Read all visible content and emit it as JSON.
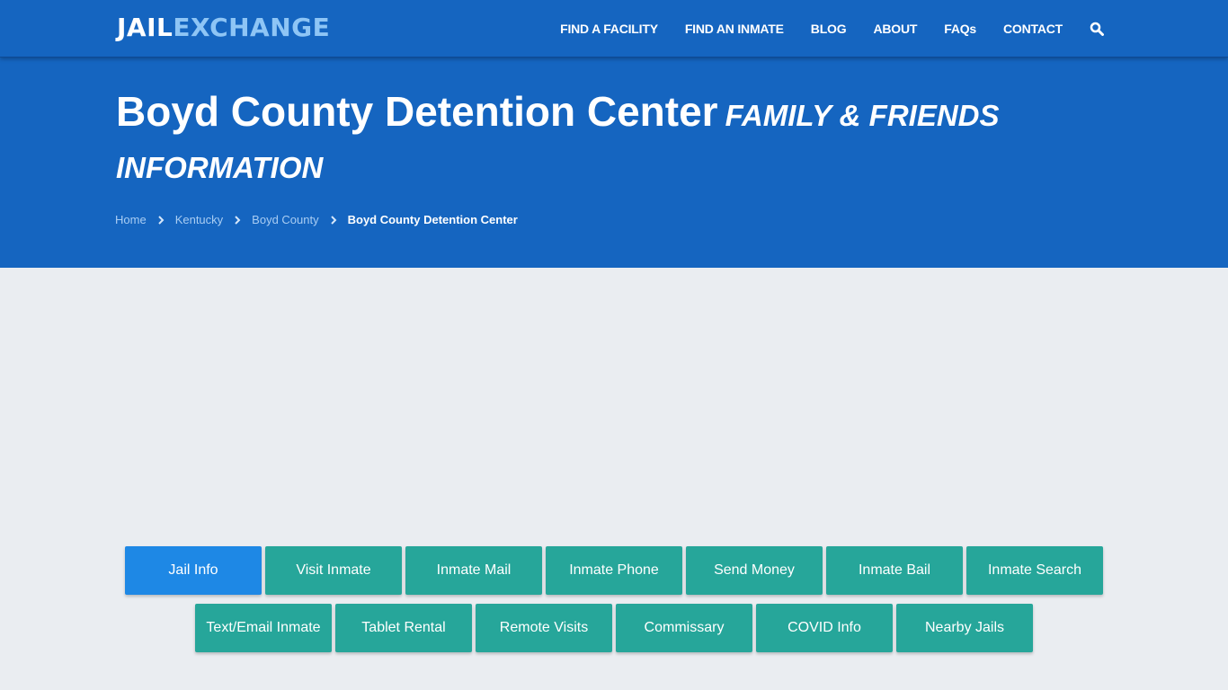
{
  "header": {
    "logo": {
      "part1": "JAIL",
      "part2": "EXCHANGE"
    },
    "nav": [
      {
        "label": "FIND A FACILITY"
      },
      {
        "label": "FIND AN INMATE"
      },
      {
        "label": "BLOG"
      },
      {
        "label": "ABOUT"
      },
      {
        "label": "FAQs"
      },
      {
        "label": "CONTACT"
      }
    ],
    "search_icon": "search-icon"
  },
  "hero": {
    "title": "Boyd County Detention Center",
    "subtitle": "FAMILY & FRIENDS INFORMATION",
    "breadcrumb": [
      {
        "label": "Home"
      },
      {
        "label": "Kentucky"
      },
      {
        "label": "Boyd County"
      },
      {
        "label": "Boyd County Detention Center"
      }
    ]
  },
  "colors": {
    "brand_blue": "#1565c0",
    "logo_accent": "#8ec5f5",
    "button_teal": "#26a69a",
    "button_active": "#1e88e5",
    "page_bg": "#eaedf1"
  },
  "buttons": {
    "row1": [
      {
        "label": "Jail Info",
        "active": true
      },
      {
        "label": "Visit Inmate"
      },
      {
        "label": "Inmate Mail"
      },
      {
        "label": "Inmate Phone"
      },
      {
        "label": "Send Money"
      },
      {
        "label": "Inmate Bail"
      },
      {
        "label": "Inmate Search"
      }
    ],
    "row2": [
      {
        "label": "Text/Email Inmate"
      },
      {
        "label": "Tablet Rental"
      },
      {
        "label": "Remote Visits"
      },
      {
        "label": "Commissary"
      },
      {
        "label": "COVID Info"
      },
      {
        "label": "Nearby Jails"
      }
    ]
  }
}
